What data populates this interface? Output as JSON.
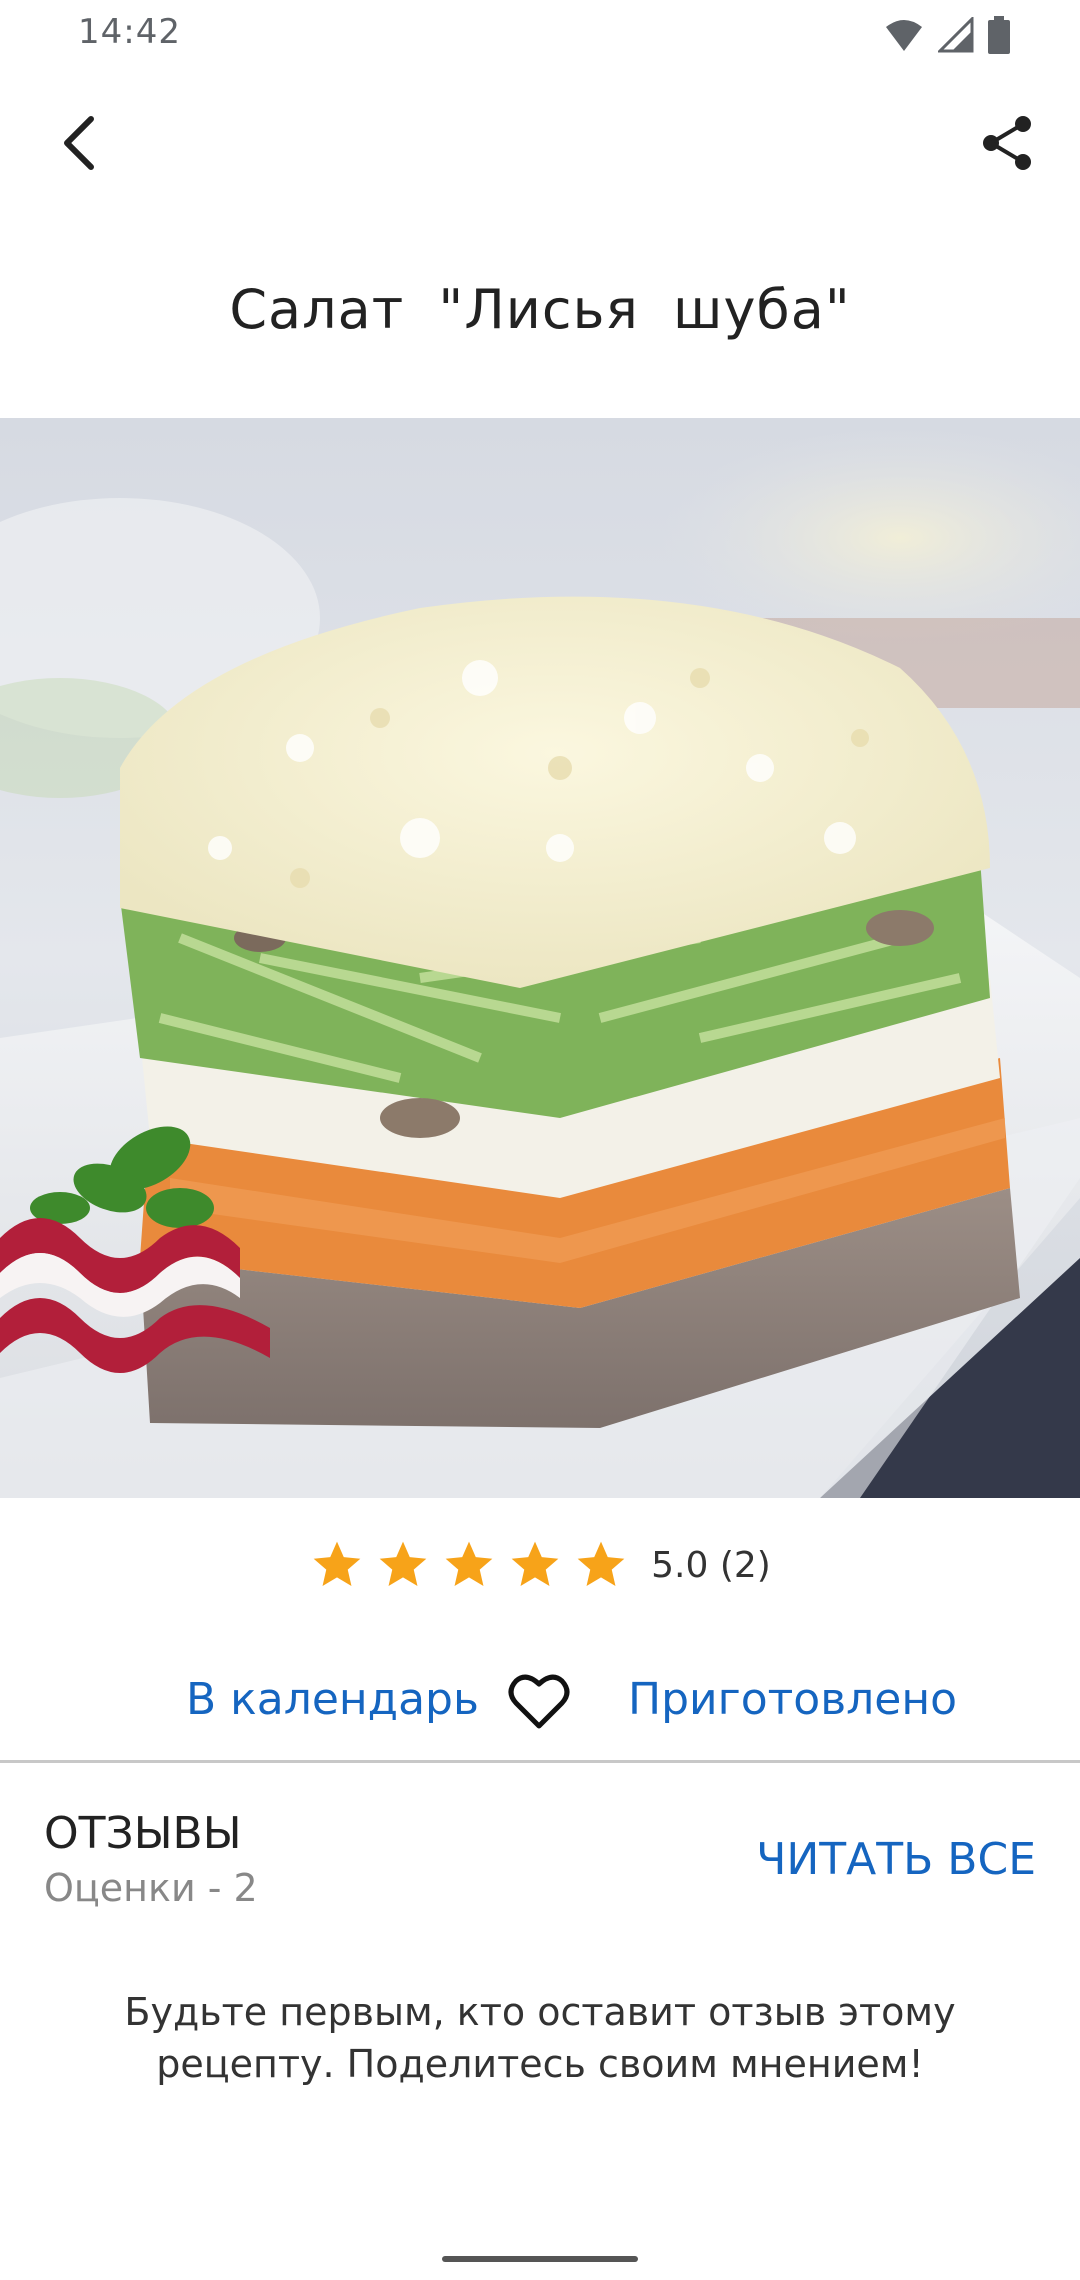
{
  "status_bar": {
    "time": "14:42",
    "icons": [
      "wifi-icon",
      "signal-icon",
      "battery-icon"
    ]
  },
  "toolbar": {
    "back_icon": "back-arrow-icon",
    "share_icon": "share-icon"
  },
  "recipe": {
    "title": "Салат \"Лисья шуба\"",
    "image_icon": "recipe-photo"
  },
  "rating": {
    "stars": 5,
    "max_stars": 5,
    "text": "5.0 (2)",
    "star_color": "#f7a319"
  },
  "actions": {
    "calendar_label": "В календарь",
    "favorite_icon": "heart-icon",
    "cooked_label": "Приготовлено",
    "link_color": "#1565c0"
  },
  "reviews": {
    "heading": "ОТЗЫВЫ",
    "count_text": "Оценки - 2",
    "read_all_label": "ЧИТАТЬ ВСЕ",
    "empty_message": "Будьте первым, кто оставит отзыв этому рецепту. Поделитесь своим мнением!"
  }
}
